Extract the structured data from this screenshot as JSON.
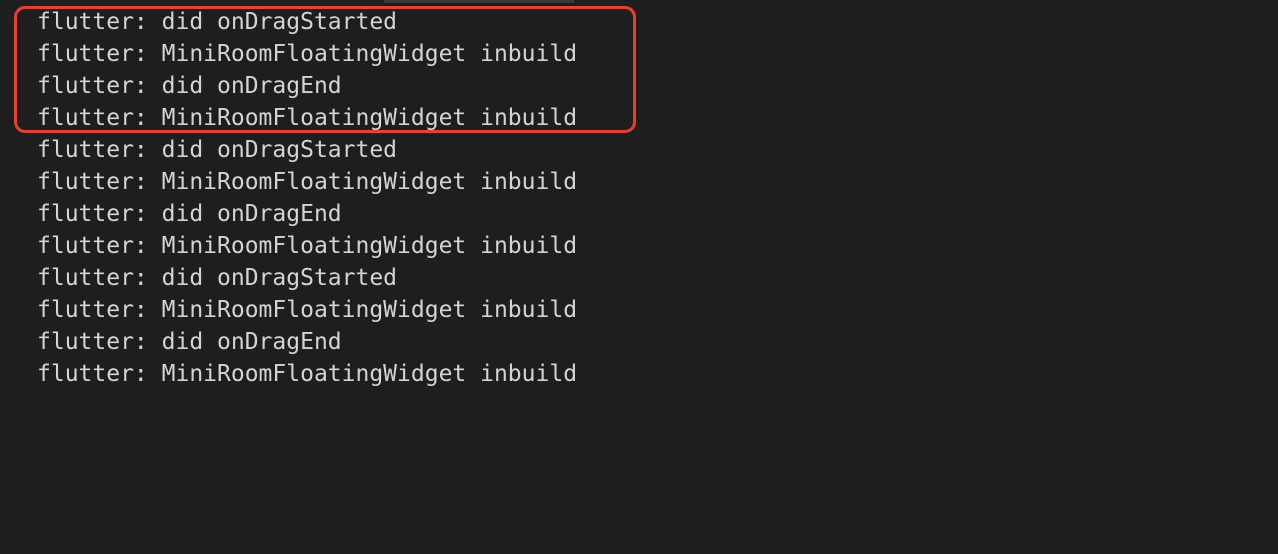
{
  "log": {
    "lines": [
      "flutter: did onDragStarted",
      "flutter: MiniRoomFloatingWidget inbuild",
      "flutter: did onDragEnd",
      "flutter: MiniRoomFloatingWidget inbuild",
      "flutter: did onDragStarted",
      "flutter: MiniRoomFloatingWidget inbuild",
      "flutter: did onDragEnd",
      "flutter: MiniRoomFloatingWidget inbuild",
      "flutter: did onDragStarted",
      "flutter: MiniRoomFloatingWidget inbuild",
      "flutter: did onDragEnd",
      "flutter: MiniRoomFloatingWidget inbuild"
    ]
  },
  "colors": {
    "background": "#1e1e1e",
    "text": "#d4d4d4",
    "highlight": "#e8412b"
  }
}
